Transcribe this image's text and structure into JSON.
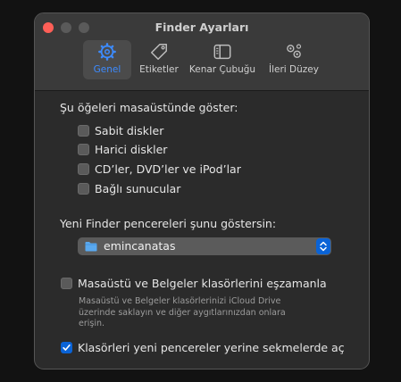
{
  "window": {
    "title": "Finder Ayarları"
  },
  "toolbar": {
    "tabs": [
      {
        "label": "Genel",
        "icon": "gear-icon",
        "active": true
      },
      {
        "label": "Etiketler",
        "icon": "tag-icon",
        "active": false
      },
      {
        "label": "Kenar Çubuğu",
        "icon": "sidebar-icon",
        "active": false
      },
      {
        "label": "İleri Düzey",
        "icon": "gears-icon",
        "active": false
      }
    ]
  },
  "desktop_section": {
    "label": "Şu öğeleri masaüstünde göster:",
    "items": [
      {
        "label": "Sabit diskler",
        "checked": false
      },
      {
        "label": "Harici diskler",
        "checked": false
      },
      {
        "label": "CD’ler, DVD’ler ve iPod’lar",
        "checked": false
      },
      {
        "label": "Bağlı sunucular",
        "checked": false
      }
    ]
  },
  "new_window": {
    "label": "Yeni Finder pencereleri şunu göstersin:",
    "selected": "emincanatas"
  },
  "sync": {
    "label": "Masaüstü ve Belgeler klasörlerini eşzamanla",
    "checked": false,
    "description_lines": [
      "Masaüstü ve Belgeler klasörlerinizi iCloud Drive",
      "üzerinde saklayın ve diğer aygıtlarınızdan onlara",
      "erişin."
    ]
  },
  "tabs_option": {
    "label": "Klasörleri yeni pencereler yerine sekmelerde aç",
    "checked": true
  },
  "colors": {
    "accent": "#0a63d6",
    "active_tab_text": "#3d8bff",
    "close": "#ff5f57"
  }
}
